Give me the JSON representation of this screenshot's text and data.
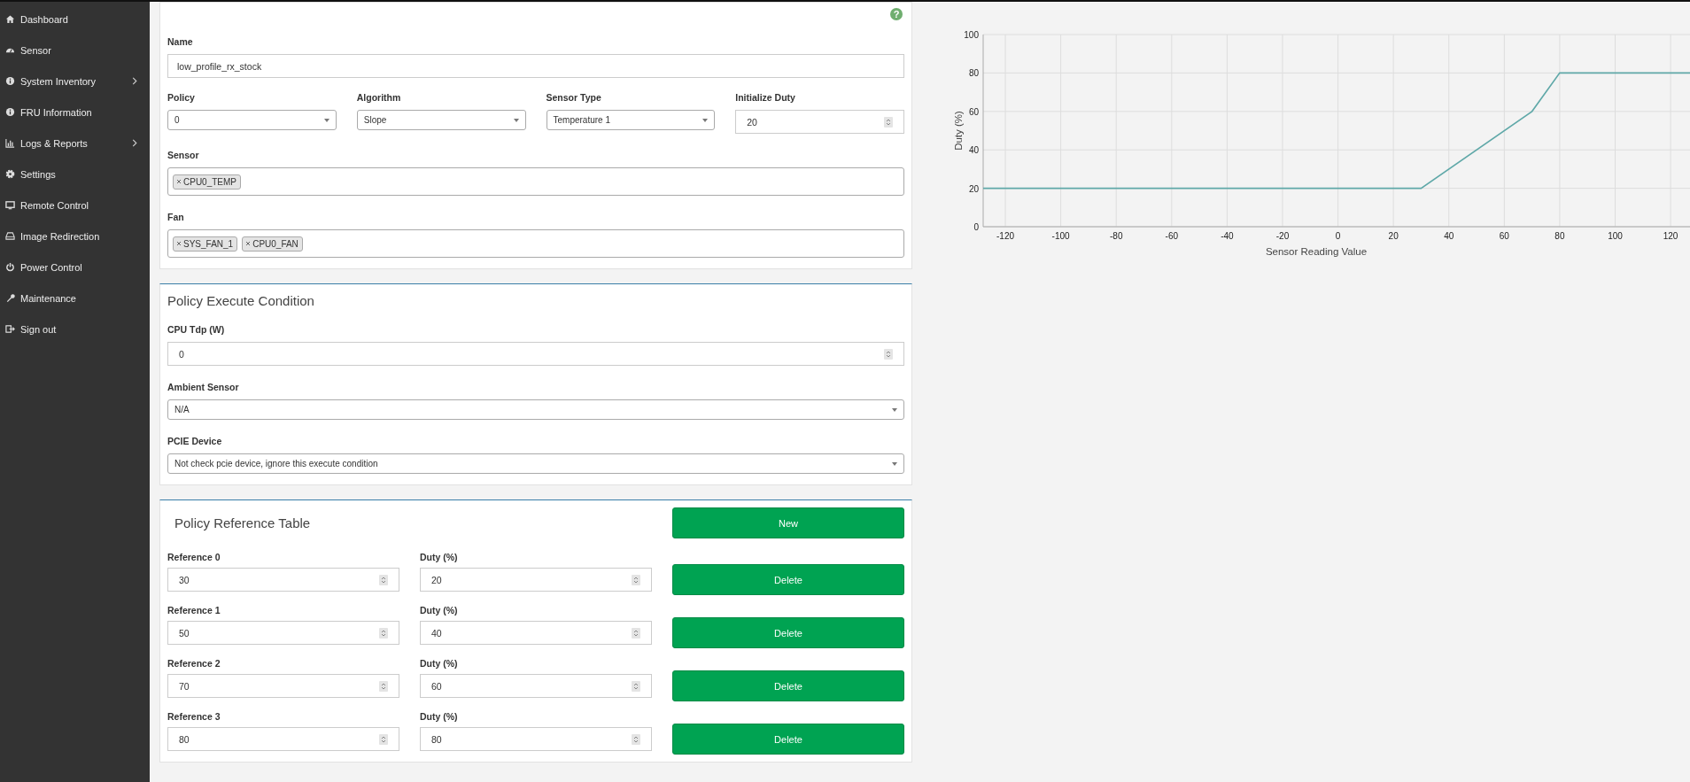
{
  "sidebar": {
    "items": [
      {
        "label": "Dashboard",
        "has_submenu": false
      },
      {
        "label": "Sensor",
        "has_submenu": false
      },
      {
        "label": "System Inventory",
        "has_submenu": true
      },
      {
        "label": "FRU Information",
        "has_submenu": false
      },
      {
        "label": "Logs & Reports",
        "has_submenu": true
      },
      {
        "label": "Settings",
        "has_submenu": false
      },
      {
        "label": "Remote Control",
        "has_submenu": false
      },
      {
        "label": "Image Redirection",
        "has_submenu": false
      },
      {
        "label": "Power Control",
        "has_submenu": false
      },
      {
        "label": "Maintenance",
        "has_submenu": false
      },
      {
        "label": "Sign out",
        "has_submenu": false
      }
    ]
  },
  "policy_form": {
    "help": "?",
    "name": {
      "label": "Name",
      "value": "low_profile_rx_stock"
    },
    "selects": [
      {
        "label": "Policy",
        "value": "0"
      },
      {
        "label": "Algorithm",
        "value": "Slope"
      },
      {
        "label": "Sensor Type",
        "value": "Temperature 1"
      }
    ],
    "initialize_duty": {
      "label": "Initialize Duty",
      "value": "20"
    },
    "sensor": {
      "label": "Sensor",
      "tags": [
        "CPU0_TEMP"
      ]
    },
    "fan": {
      "label": "Fan",
      "tags": [
        "SYS_FAN_1",
        "CPU0_FAN"
      ]
    }
  },
  "execute_condition": {
    "title": "Policy Execute Condition",
    "cpu_tdp": {
      "label": "CPU Tdp (W)",
      "value": "0"
    },
    "ambient_sensor": {
      "label": "Ambient Sensor",
      "value": "N/A"
    },
    "pcie_device": {
      "label": "PCIE Device",
      "value": "Not check pcie device, ignore this execute condition"
    }
  },
  "reference_table": {
    "title": "Policy Reference Table",
    "new_button": "New",
    "rows": [
      {
        "reference_label": "Reference 0",
        "reference": "30",
        "duty_label": "Duty (%)",
        "duty": "20",
        "delete_button": "Delete"
      },
      {
        "reference_label": "Reference 1",
        "reference": "50",
        "duty_label": "Duty (%)",
        "duty": "40",
        "delete_button": "Delete"
      },
      {
        "reference_label": "Reference 2",
        "reference": "70",
        "duty_label": "Duty (%)",
        "duty": "60",
        "delete_button": "Delete"
      },
      {
        "reference_label": "Reference 3",
        "reference": "80",
        "duty_label": "Duty (%)",
        "duty": "80",
        "delete_button": "Delete"
      }
    ]
  },
  "chart": {
    "chart_data": {
      "type": "line",
      "xlabel": "Sensor Reading Value",
      "ylabel": "Duty (%)",
      "x": [
        -128,
        30,
        70,
        80,
        127
      ],
      "series": [
        {
          "color": "#5fa8a8",
          "values": [
            20,
            20,
            60,
            80,
            80
          ]
        }
      ],
      "grid": true,
      "xlim": [
        -128,
        127
      ],
      "ylim": [
        0,
        100
      ],
      "xticks": [
        -120,
        -100,
        -80,
        -60,
        -40,
        -20,
        0,
        20,
        40,
        60,
        80,
        100,
        120
      ],
      "yticks": [
        0,
        20,
        40,
        60,
        80,
        100
      ]
    }
  }
}
